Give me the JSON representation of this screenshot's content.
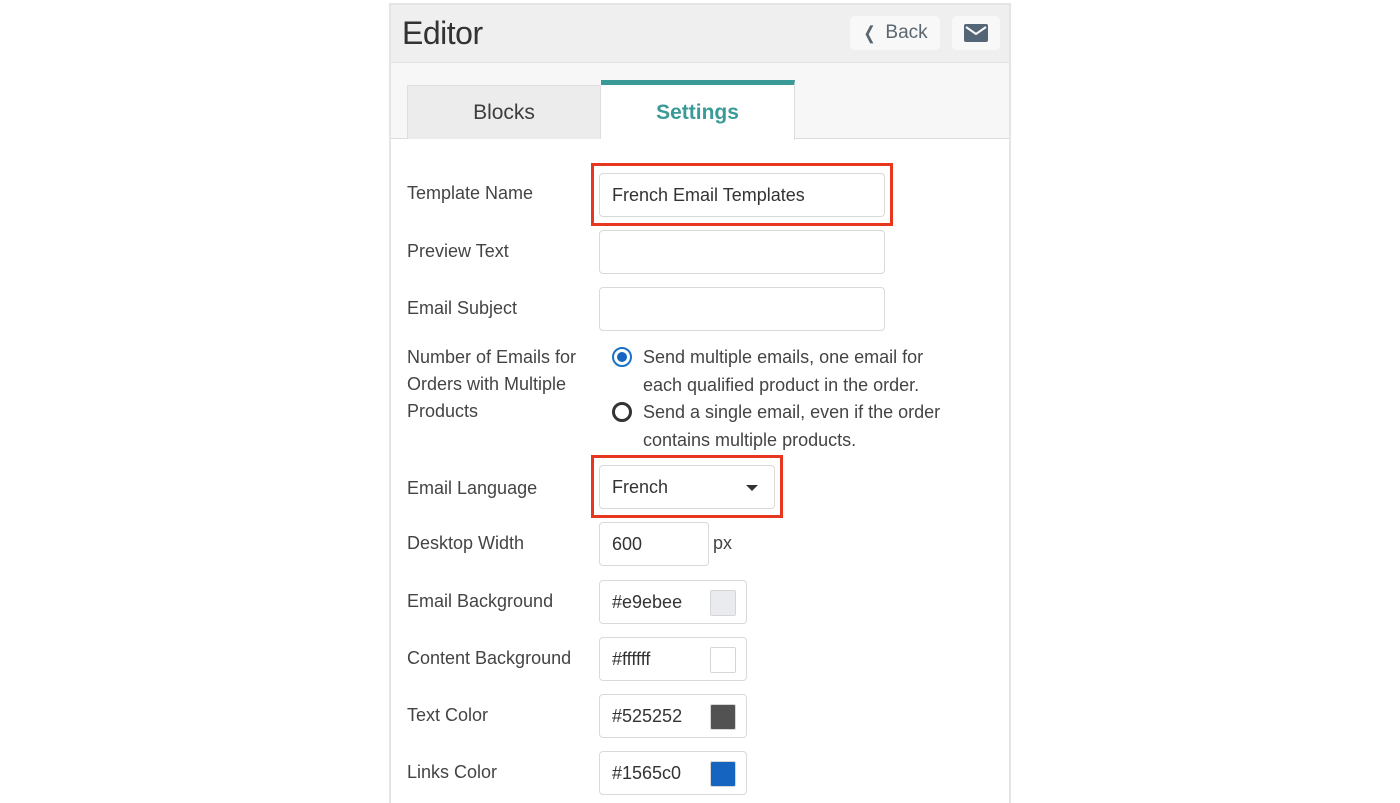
{
  "header": {
    "title": "Editor",
    "back_label": "Back",
    "back_icon": "chevron-left-icon",
    "mail_icon": "envelope-icon"
  },
  "tabs": [
    {
      "label": "Blocks",
      "active": false
    },
    {
      "label": "Settings",
      "active": true
    }
  ],
  "form": {
    "template_name": {
      "label": "Template Name",
      "value": "French Email Templates",
      "highlighted": true
    },
    "preview_text": {
      "label": "Preview Text",
      "value": ""
    },
    "email_subject": {
      "label": "Email Subject",
      "value": ""
    },
    "emails_per_order": {
      "label_lines": [
        "Number of Emails for",
        "Orders with Multiple",
        "Products"
      ],
      "options": [
        {
          "lines": [
            "Send multiple emails, one email for",
            "each qualified product in the order."
          ],
          "selected": true
        },
        {
          "lines": [
            "Send a single email, even if the order",
            "contains multiple products."
          ],
          "selected": false
        }
      ]
    },
    "email_language": {
      "label": "Email Language",
      "value": "French",
      "highlighted": true
    },
    "desktop_width": {
      "label": "Desktop Width",
      "value": "600",
      "unit": "px"
    },
    "email_background": {
      "label": "Email Background",
      "value": "#e9ebee",
      "swatch": "#e9ebee"
    },
    "content_background": {
      "label": "Content Background",
      "value": "#ffffff",
      "swatch": "#ffffff"
    },
    "text_color": {
      "label": "Text Color",
      "value": "#525252",
      "swatch": "#525252"
    },
    "links_color": {
      "label": "Links Color",
      "value": "#1565c0",
      "swatch": "#1565c0"
    }
  },
  "colors": {
    "accent": "#3a9a98",
    "highlight": "#e8371f",
    "radio": "#1565c0"
  }
}
